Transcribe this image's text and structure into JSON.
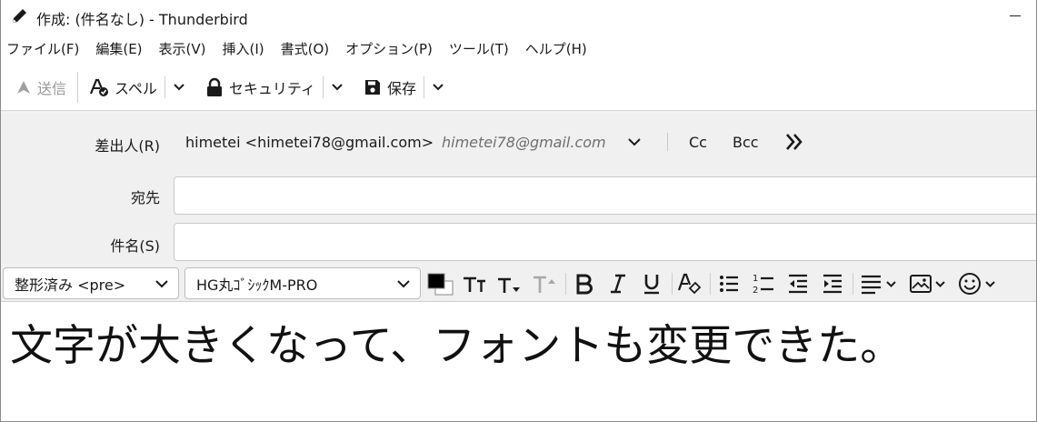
{
  "window": {
    "title": "作成: (件名なし) - Thunderbird"
  },
  "menu": {
    "items": [
      "ファイル(F)",
      "編集(E)",
      "表示(V)",
      "挿入(I)",
      "書式(O)",
      "オプション(P)",
      "ツール(T)",
      "ヘルプ(H)"
    ]
  },
  "toolbar": {
    "send_label": "送信",
    "spell_label": "スペル",
    "security_label": "セキュリティ",
    "save_label": "保存"
  },
  "header": {
    "from_label": "差出人(R)",
    "from_name": "himetei <himetei78@gmail.com>",
    "from_identity": "himetei78@gmail.com",
    "cc_label": "Cc",
    "bcc_label": "Bcc",
    "to_label": "宛先",
    "to_value": "",
    "subject_label": "件名(S)",
    "subject_value": ""
  },
  "format": {
    "paragraph_format": "整形済み <pre>",
    "font": "HG丸ｺﾞｼｯｸM-PRO",
    "text_color": "#000000",
    "background_color": "#ffffff"
  },
  "body": {
    "text": "文字が大きくなって、フォントも変更できた。"
  },
  "colors": {
    "header_bg": "#f0f0f0",
    "disabled_text": "#9a9a9a",
    "identity_text": "#6f6f6f"
  }
}
